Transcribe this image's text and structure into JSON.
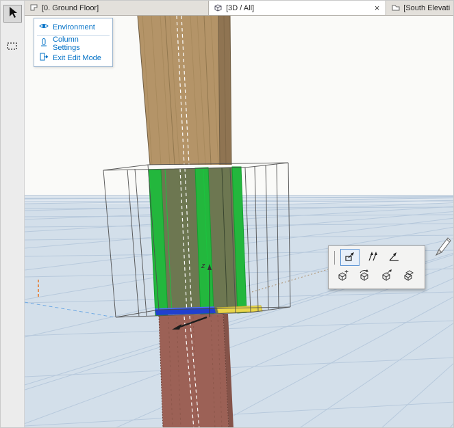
{
  "tabs": [
    {
      "label": "[0. Ground Floor]",
      "icon": "floor-plan-icon",
      "active": false
    },
    {
      "label": "[3D / All]",
      "icon": "box-3d-icon",
      "active": true,
      "close_label": "×"
    },
    {
      "label": "[South Elevati",
      "icon": "elevation-icon",
      "active": false
    }
  ],
  "left_toolbar": {
    "tools": [
      {
        "name": "select-arrow",
        "selected": true
      },
      {
        "name": "marquee-select",
        "selected": false
      }
    ]
  },
  "edit_menu": {
    "items": [
      {
        "label": "Environment",
        "icon": "eye-icon"
      },
      {
        "label": "Column Settings",
        "icon": "column-icon"
      },
      {
        "label": "Exit Edit Mode",
        "icon": "exit-icon"
      }
    ]
  },
  "pet_palette": {
    "row1": [
      {
        "name": "stretch",
        "selected": true
      },
      {
        "name": "skew",
        "selected": false
      },
      {
        "name": "skew-angle",
        "selected": false
      }
    ],
    "row2": [
      {
        "name": "move-box",
        "selected": false
      },
      {
        "name": "rotate-box",
        "selected": false
      },
      {
        "name": "offset-box",
        "selected": false
      },
      {
        "name": "multiply-box",
        "selected": false
      }
    ]
  },
  "scene": {
    "axis_label": "z"
  },
  "colors": {
    "accent_blue": "#0070c6",
    "selection_green": "#23b73d",
    "floor_blue": "#d3dfea",
    "grid_line": "#b7c9dc",
    "wood": "#b49468",
    "lower_column_brown": "#9c6156",
    "highlight_blue": "#2140cf",
    "highlight_yellow": "#e9d74b"
  }
}
